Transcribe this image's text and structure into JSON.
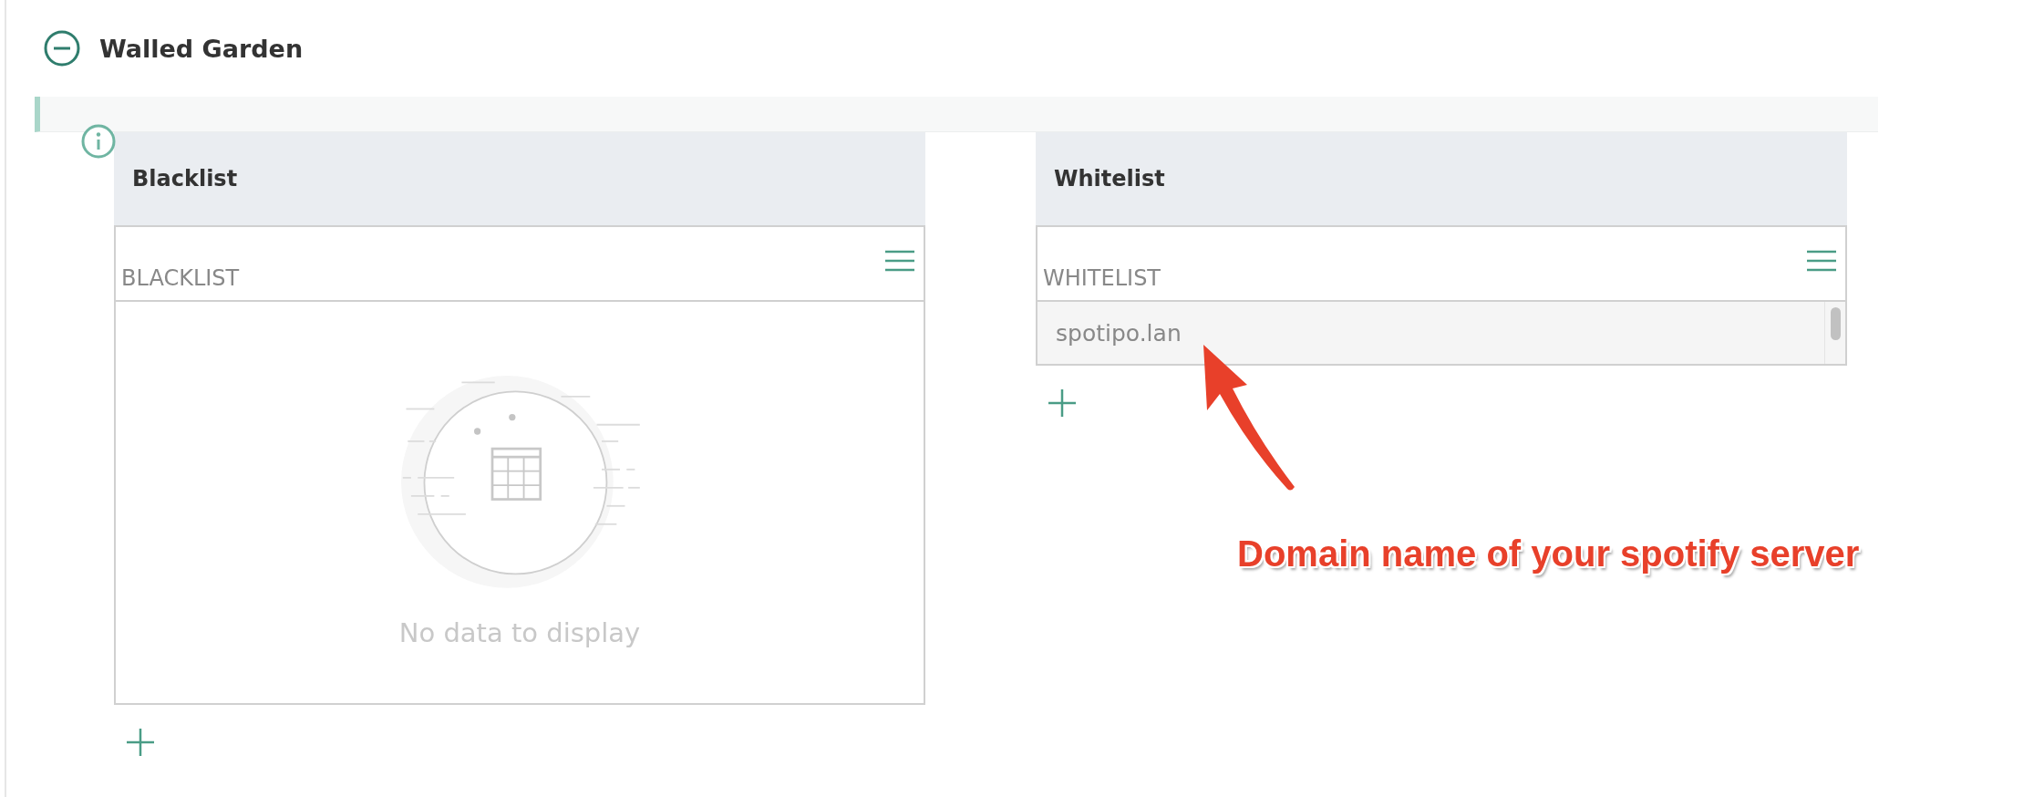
{
  "section": {
    "title": "Walled Garden",
    "expanded": true
  },
  "panels": [
    {
      "title": "Blacklist",
      "column": "BLACKLIST",
      "empty_message": "No data to display"
    },
    {
      "title": "Whitelist",
      "column": "WHITELIST",
      "rows": [
        "spotipo.lan"
      ]
    }
  ],
  "annotation": {
    "text": "Domain name of your spotify server"
  }
}
